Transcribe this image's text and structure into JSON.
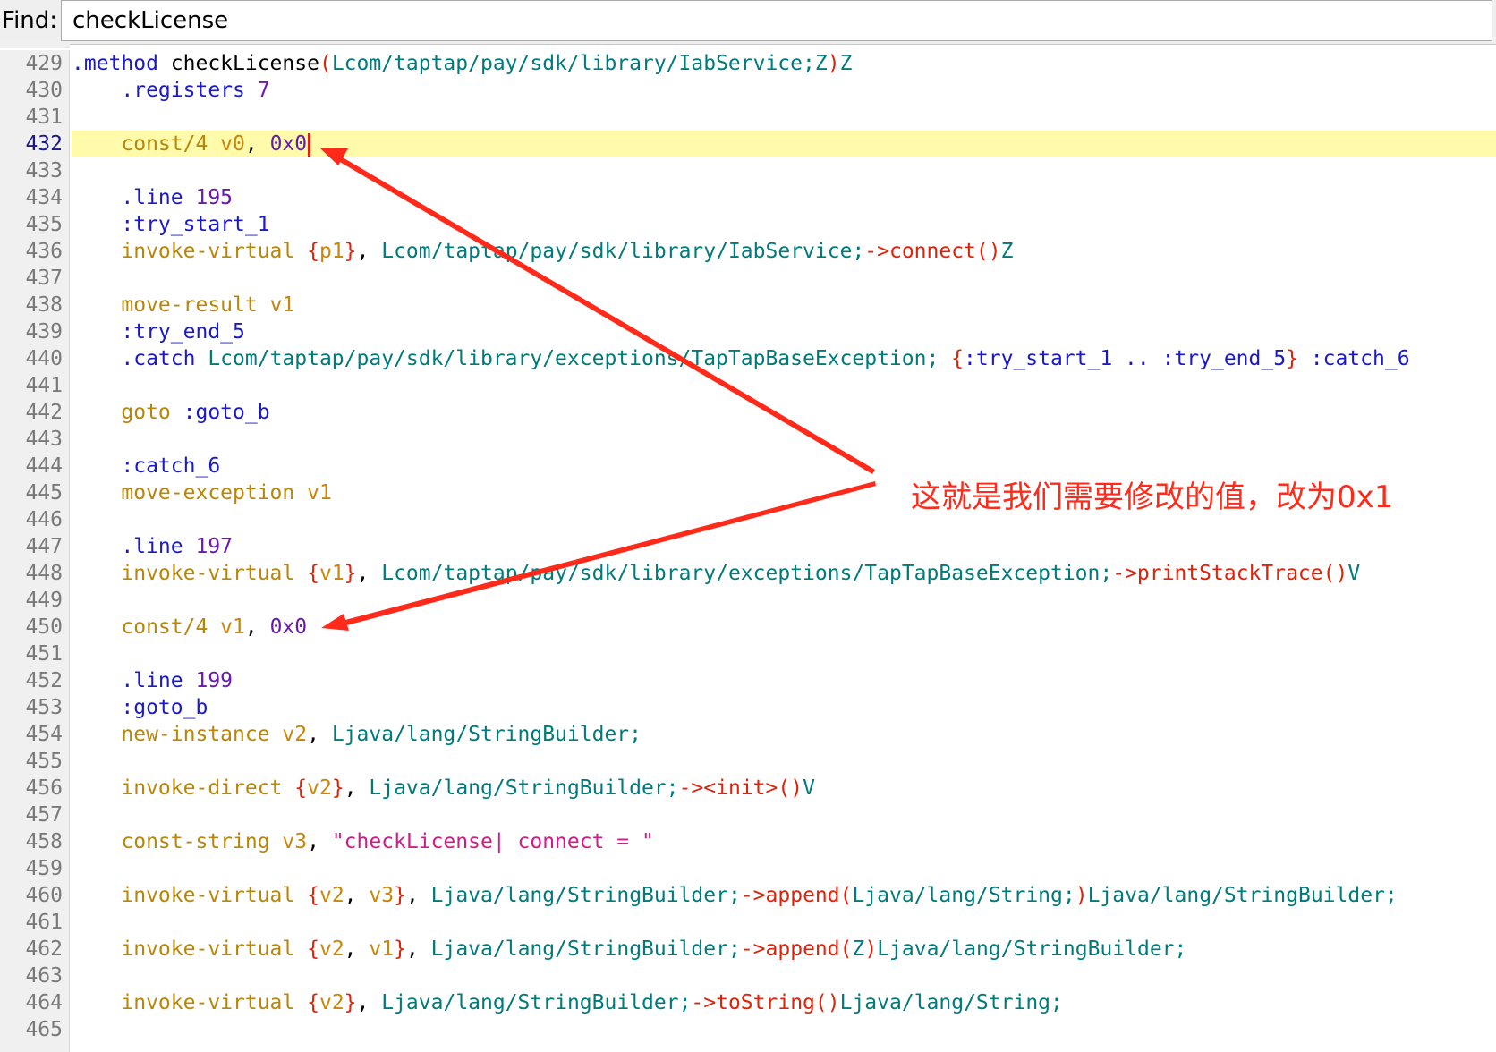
{
  "find": {
    "label": "Find:",
    "value": "checkLicense"
  },
  "current_line": "432",
  "annotation": {
    "text": "这就是我们需要修改的值，改为0x1",
    "color": "#ff2a1a"
  },
  "colors": {
    "current_line_bg": "#fffbaa",
    "gutter_bg": "#f0f0f0"
  },
  "lines": [
    {
      "n": "429",
      "tokens": [
        {
          "t": ".method ",
          "c": "dir"
        },
        {
          "t": "checkLicense",
          "c": "plain"
        },
        {
          "t": "(",
          "c": "brace"
        },
        {
          "t": "Lcom/taptap/pay/sdk/library/IabService;Z",
          "c": "type"
        },
        {
          "t": ")",
          "c": "brace"
        },
        {
          "t": "Z",
          "c": "type"
        }
      ]
    },
    {
      "n": "430",
      "tokens": [
        {
          "t": "    ",
          "c": "plain"
        },
        {
          "t": ".registers ",
          "c": "dir"
        },
        {
          "t": "7",
          "c": "num"
        }
      ]
    },
    {
      "n": "431",
      "tokens": []
    },
    {
      "n": "432",
      "tokens": [
        {
          "t": "    ",
          "c": "plain"
        },
        {
          "t": "const/4 ",
          "c": "kw"
        },
        {
          "t": "v0",
          "c": "reg"
        },
        {
          "t": ", ",
          "c": "plain"
        },
        {
          "t": "0x0",
          "c": "num"
        }
      ]
    },
    {
      "n": "433",
      "tokens": []
    },
    {
      "n": "434",
      "tokens": [
        {
          "t": "    ",
          "c": "plain"
        },
        {
          "t": ".line ",
          "c": "dir"
        },
        {
          "t": "195",
          "c": "num"
        }
      ]
    },
    {
      "n": "435",
      "tokens": [
        {
          "t": "    ",
          "c": "plain"
        },
        {
          "t": ":try_start_1",
          "c": "dir"
        }
      ]
    },
    {
      "n": "436",
      "tokens": [
        {
          "t": "    ",
          "c": "plain"
        },
        {
          "t": "invoke-virtual ",
          "c": "kw"
        },
        {
          "t": "{",
          "c": "brace"
        },
        {
          "t": "p1",
          "c": "reg"
        },
        {
          "t": "}",
          "c": "brace"
        },
        {
          "t": ", ",
          "c": "plain"
        },
        {
          "t": "Lcom/taptap/pay/sdk/library/IabService;",
          "c": "type"
        },
        {
          "t": "->connect",
          "c": "meth"
        },
        {
          "t": "()",
          "c": "brace"
        },
        {
          "t": "Z",
          "c": "type"
        }
      ]
    },
    {
      "n": "437",
      "tokens": []
    },
    {
      "n": "438",
      "tokens": [
        {
          "t": "    ",
          "c": "plain"
        },
        {
          "t": "move-result ",
          "c": "kw"
        },
        {
          "t": "v1",
          "c": "reg"
        }
      ]
    },
    {
      "n": "439",
      "tokens": [
        {
          "t": "    ",
          "c": "plain"
        },
        {
          "t": ":try_end_5",
          "c": "dir"
        }
      ]
    },
    {
      "n": "440",
      "tokens": [
        {
          "t": "    ",
          "c": "plain"
        },
        {
          "t": ".catch ",
          "c": "dir"
        },
        {
          "t": "Lcom/taptap/pay/sdk/library/exceptions/TapTapBaseException; ",
          "c": "type"
        },
        {
          "t": "{",
          "c": "brace"
        },
        {
          "t": ":try_start_1 .. :try_end_5",
          "c": "dir"
        },
        {
          "t": "}",
          "c": "brace"
        },
        {
          "t": " :catch_6",
          "c": "dir"
        }
      ]
    },
    {
      "n": "441",
      "tokens": []
    },
    {
      "n": "442",
      "tokens": [
        {
          "t": "    ",
          "c": "plain"
        },
        {
          "t": "goto ",
          "c": "kw"
        },
        {
          "t": ":goto_b",
          "c": "dir"
        }
      ]
    },
    {
      "n": "443",
      "tokens": []
    },
    {
      "n": "444",
      "tokens": [
        {
          "t": "    ",
          "c": "plain"
        },
        {
          "t": ":catch_6",
          "c": "dir"
        }
      ]
    },
    {
      "n": "445",
      "tokens": [
        {
          "t": "    ",
          "c": "plain"
        },
        {
          "t": "move-exception ",
          "c": "kw"
        },
        {
          "t": "v1",
          "c": "reg"
        }
      ]
    },
    {
      "n": "446",
      "tokens": []
    },
    {
      "n": "447",
      "tokens": [
        {
          "t": "    ",
          "c": "plain"
        },
        {
          "t": ".line ",
          "c": "dir"
        },
        {
          "t": "197",
          "c": "num"
        }
      ]
    },
    {
      "n": "448",
      "tokens": [
        {
          "t": "    ",
          "c": "plain"
        },
        {
          "t": "invoke-virtual ",
          "c": "kw"
        },
        {
          "t": "{",
          "c": "brace"
        },
        {
          "t": "v1",
          "c": "reg"
        },
        {
          "t": "}",
          "c": "brace"
        },
        {
          "t": ", ",
          "c": "plain"
        },
        {
          "t": "Lcom/taptap/pay/sdk/library/exceptions/TapTapBaseException;",
          "c": "type"
        },
        {
          "t": "->printStackTrace",
          "c": "meth"
        },
        {
          "t": "()",
          "c": "brace"
        },
        {
          "t": "V",
          "c": "type"
        }
      ]
    },
    {
      "n": "449",
      "tokens": []
    },
    {
      "n": "450",
      "tokens": [
        {
          "t": "    ",
          "c": "plain"
        },
        {
          "t": "const/4 ",
          "c": "kw"
        },
        {
          "t": "v1",
          "c": "reg"
        },
        {
          "t": ", ",
          "c": "plain"
        },
        {
          "t": "0x0",
          "c": "num"
        }
      ]
    },
    {
      "n": "451",
      "tokens": []
    },
    {
      "n": "452",
      "tokens": [
        {
          "t": "    ",
          "c": "plain"
        },
        {
          "t": ".line ",
          "c": "dir"
        },
        {
          "t": "199",
          "c": "num"
        }
      ]
    },
    {
      "n": "453",
      "tokens": [
        {
          "t": "    ",
          "c": "plain"
        },
        {
          "t": ":goto_b",
          "c": "dir"
        }
      ]
    },
    {
      "n": "454",
      "tokens": [
        {
          "t": "    ",
          "c": "plain"
        },
        {
          "t": "new-instance ",
          "c": "kw"
        },
        {
          "t": "v2",
          "c": "reg"
        },
        {
          "t": ", ",
          "c": "plain"
        },
        {
          "t": "Ljava/lang/StringBuilder;",
          "c": "type"
        }
      ]
    },
    {
      "n": "455",
      "tokens": []
    },
    {
      "n": "456",
      "tokens": [
        {
          "t": "    ",
          "c": "plain"
        },
        {
          "t": "invoke-direct ",
          "c": "kw"
        },
        {
          "t": "{",
          "c": "brace"
        },
        {
          "t": "v2",
          "c": "reg"
        },
        {
          "t": "}",
          "c": "brace"
        },
        {
          "t": ", ",
          "c": "plain"
        },
        {
          "t": "Ljava/lang/StringBuilder;",
          "c": "type"
        },
        {
          "t": "-><init>",
          "c": "meth"
        },
        {
          "t": "()",
          "c": "brace"
        },
        {
          "t": "V",
          "c": "type"
        }
      ]
    },
    {
      "n": "457",
      "tokens": []
    },
    {
      "n": "458",
      "tokens": [
        {
          "t": "    ",
          "c": "plain"
        },
        {
          "t": "const-string ",
          "c": "kw"
        },
        {
          "t": "v3",
          "c": "reg"
        },
        {
          "t": ", ",
          "c": "plain"
        },
        {
          "t": "\"checkLicense| connect = \"",
          "c": "str"
        }
      ]
    },
    {
      "n": "459",
      "tokens": []
    },
    {
      "n": "460",
      "tokens": [
        {
          "t": "    ",
          "c": "plain"
        },
        {
          "t": "invoke-virtual ",
          "c": "kw"
        },
        {
          "t": "{",
          "c": "brace"
        },
        {
          "t": "v2",
          "c": "reg"
        },
        {
          "t": ", ",
          "c": "plain"
        },
        {
          "t": "v3",
          "c": "reg"
        },
        {
          "t": "}",
          "c": "brace"
        },
        {
          "t": ", ",
          "c": "plain"
        },
        {
          "t": "Ljava/lang/StringBuilder;",
          "c": "type"
        },
        {
          "t": "->append",
          "c": "meth"
        },
        {
          "t": "(",
          "c": "brace"
        },
        {
          "t": "Ljava/lang/String;",
          "c": "type"
        },
        {
          "t": ")",
          "c": "brace"
        },
        {
          "t": "Ljava/lang/StringBuilder;",
          "c": "type"
        }
      ]
    },
    {
      "n": "461",
      "tokens": []
    },
    {
      "n": "462",
      "tokens": [
        {
          "t": "    ",
          "c": "plain"
        },
        {
          "t": "invoke-virtual ",
          "c": "kw"
        },
        {
          "t": "{",
          "c": "brace"
        },
        {
          "t": "v2",
          "c": "reg"
        },
        {
          "t": ", ",
          "c": "plain"
        },
        {
          "t": "v1",
          "c": "reg"
        },
        {
          "t": "}",
          "c": "brace"
        },
        {
          "t": ", ",
          "c": "plain"
        },
        {
          "t": "Ljava/lang/StringBuilder;",
          "c": "type"
        },
        {
          "t": "->append",
          "c": "meth"
        },
        {
          "t": "(",
          "c": "brace"
        },
        {
          "t": "Z",
          "c": "type"
        },
        {
          "t": ")",
          "c": "brace"
        },
        {
          "t": "Ljava/lang/StringBuilder;",
          "c": "type"
        }
      ]
    },
    {
      "n": "463",
      "tokens": []
    },
    {
      "n": "464",
      "tokens": [
        {
          "t": "    ",
          "c": "plain"
        },
        {
          "t": "invoke-virtual ",
          "c": "kw"
        },
        {
          "t": "{",
          "c": "brace"
        },
        {
          "t": "v2",
          "c": "reg"
        },
        {
          "t": "}",
          "c": "brace"
        },
        {
          "t": ", ",
          "c": "plain"
        },
        {
          "t": "Ljava/lang/StringBuilder;",
          "c": "type"
        },
        {
          "t": "->toString",
          "c": "meth"
        },
        {
          "t": "()",
          "c": "brace"
        },
        {
          "t": "Ljava/lang/String;",
          "c": "type"
        }
      ]
    },
    {
      "n": "465",
      "tokens": []
    }
  ]
}
